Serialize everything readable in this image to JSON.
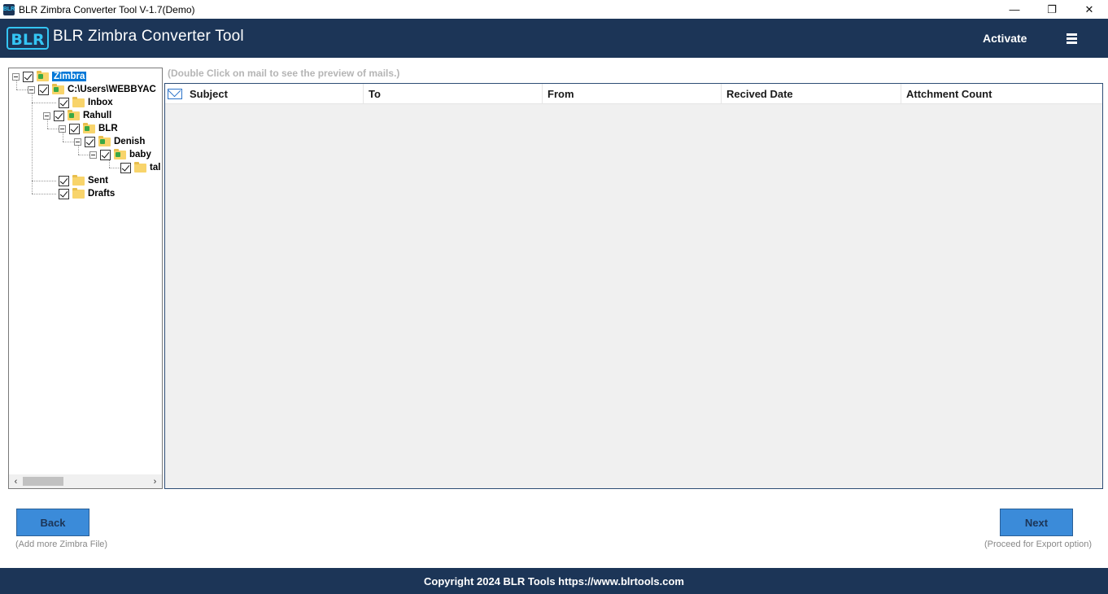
{
  "window": {
    "title": "BLR Zimbra Converter Tool V-1.7(Demo)",
    "app_icon_text": "BLR",
    "minimize": "—",
    "restore": "❐",
    "close": "✕"
  },
  "header": {
    "app_name": "BLR Zimbra Converter Tool",
    "logo_text": "BLR",
    "activate_label": "Activate",
    "background": "#1c3557"
  },
  "tree": {
    "nodes": [
      {
        "label": "Zimbra",
        "selected": true
      },
      {
        "label": "C:\\Users\\WEBBYAC"
      },
      {
        "label": "Inbox"
      },
      {
        "label": "Rahull"
      },
      {
        "label": "BLR"
      },
      {
        "label": "Denish"
      },
      {
        "label": "baby"
      },
      {
        "label": "tal"
      },
      {
        "label": "Sent"
      },
      {
        "label": "Drafts"
      }
    ],
    "scroll_left": "‹",
    "scroll_right": "›"
  },
  "grid": {
    "hint": "(Double Click on mail to see the preview of mails.)",
    "columns": [
      "Subject",
      "To",
      "From",
      "Recived Date",
      "Attchment Count"
    ]
  },
  "actions": {
    "back_label": "Back",
    "back_note": "(Add more Zimbra File)",
    "next_label": "Next",
    "next_note": "(Proceed for Export option)",
    "button_color": "#3b8bd9"
  },
  "footer": {
    "text": "Copyright 2024 BLR Tools https://www.blrtools.com"
  }
}
